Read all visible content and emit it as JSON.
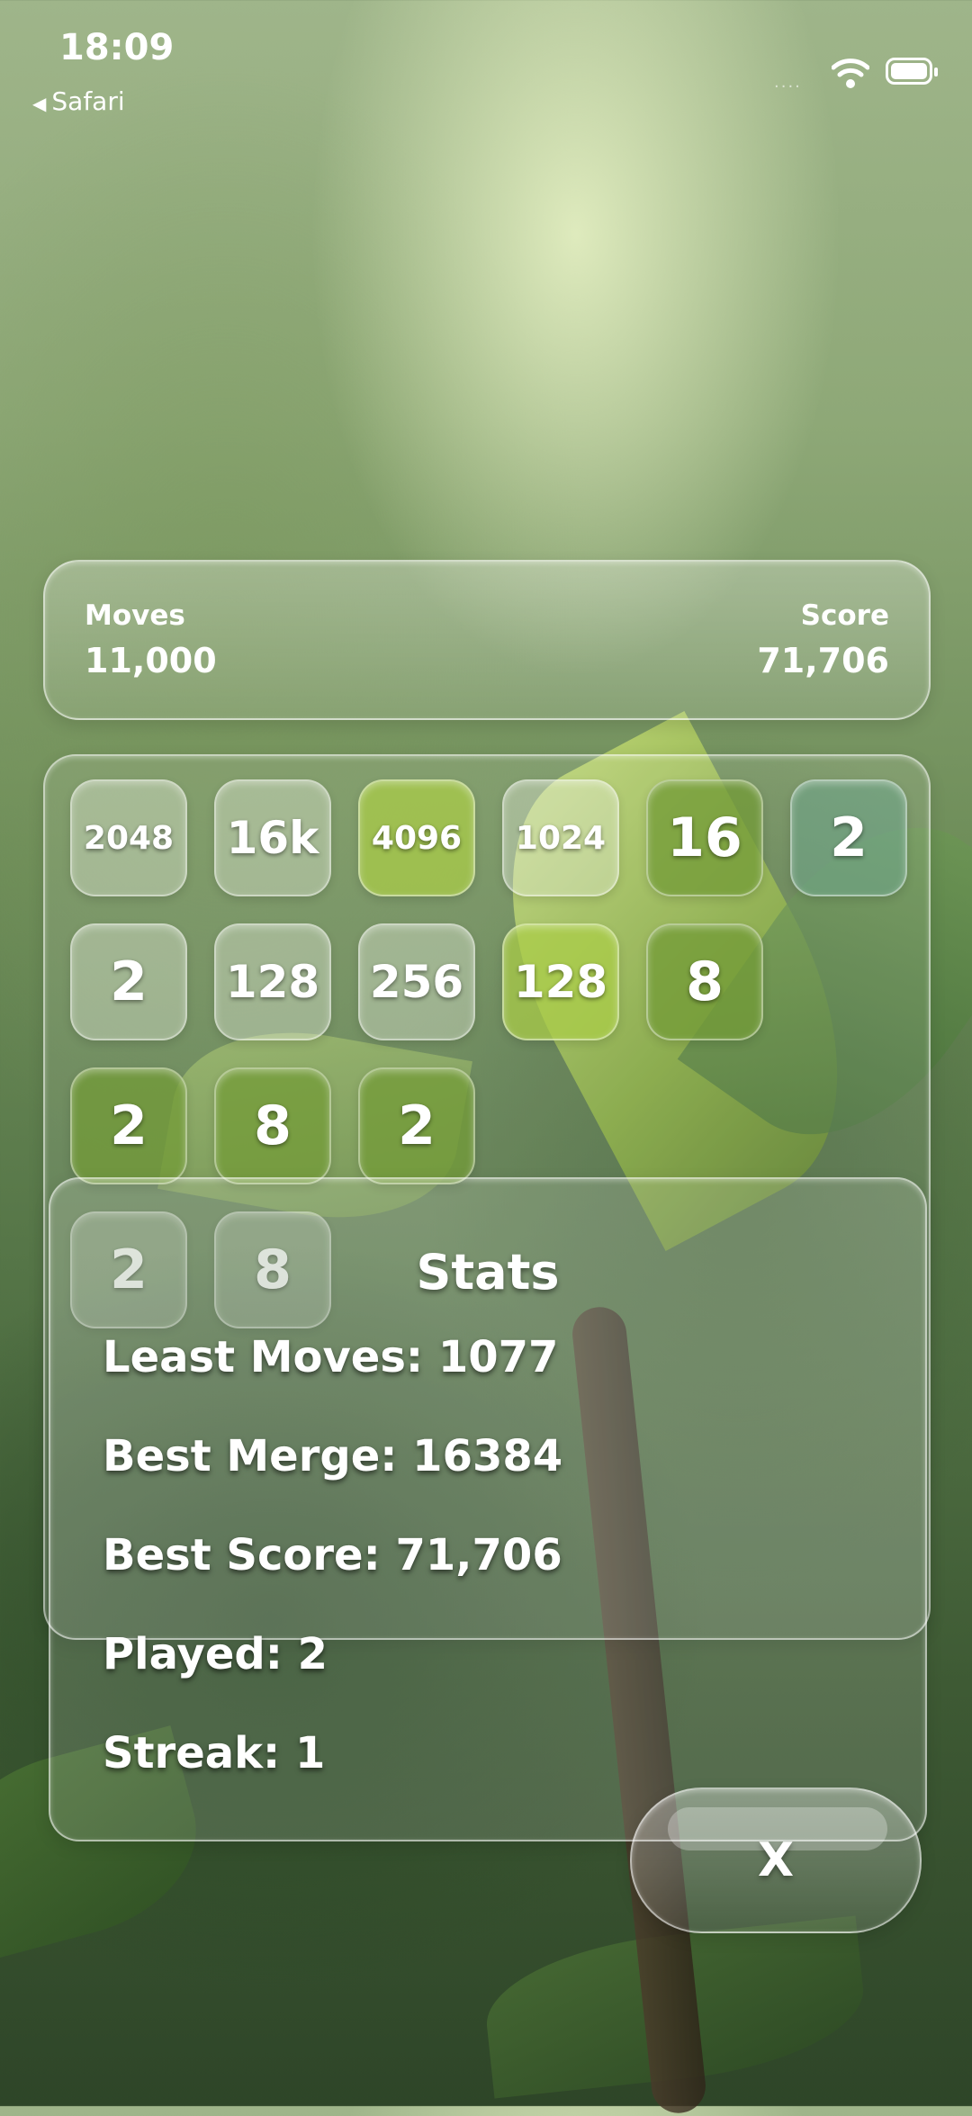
{
  "status_bar": {
    "time": "18:09",
    "back_label": "Safari",
    "signal": "····"
  },
  "header": {
    "moves_label": "Moves",
    "moves_value": "11,000",
    "score_label": "Score",
    "score_value": "71,706"
  },
  "board": {
    "tiles": [
      {
        "row": 0,
        "col": 0,
        "value": "2048",
        "style": "clear",
        "size": "s"
      },
      {
        "row": 0,
        "col": 1,
        "value": "16k",
        "style": "clear",
        "size": "m"
      },
      {
        "row": 0,
        "col": 2,
        "value": "4096",
        "style": "lime",
        "size": "s"
      },
      {
        "row": 0,
        "col": 3,
        "value": "1024",
        "style": "clear",
        "size": "s"
      },
      {
        "row": 0,
        "col": 4,
        "value": "16",
        "style": "olive",
        "size": "l"
      },
      {
        "row": 0,
        "col": 5,
        "value": "2",
        "style": "teal",
        "size": "l"
      },
      {
        "row": 1,
        "col": 0,
        "value": "2",
        "style": "clear",
        "size": "l"
      },
      {
        "row": 1,
        "col": 1,
        "value": "128",
        "style": "clear",
        "size": "m"
      },
      {
        "row": 1,
        "col": 2,
        "value": "256",
        "style": "clear",
        "size": "m"
      },
      {
        "row": 1,
        "col": 3,
        "value": "128",
        "style": "lime",
        "size": "m"
      },
      {
        "row": 1,
        "col": 4,
        "value": "8",
        "style": "olive",
        "size": "l"
      },
      {
        "row": 2,
        "col": 0,
        "value": "2",
        "style": "olive",
        "size": "l"
      },
      {
        "row": 2,
        "col": 1,
        "value": "8",
        "style": "olive",
        "size": "l"
      },
      {
        "row": 2,
        "col": 2,
        "value": "2",
        "style": "olive",
        "size": "l"
      },
      {
        "row": 3,
        "col": 0,
        "value": "2",
        "style": "ghost",
        "size": "l"
      },
      {
        "row": 3,
        "col": 1,
        "value": "8",
        "style": "ghost",
        "size": "l"
      }
    ]
  },
  "stats": {
    "title": "Stats",
    "least_moves": "Least Moves: 1077",
    "best_merge": "Best Merge: 16384",
    "best_score": "Best Score: 71,706",
    "played": "Played: 2",
    "streak": "Streak: 1"
  },
  "close_button": {
    "label": "X"
  },
  "colors": {
    "lime": "#aacd46",
    "olive": "#739b37",
    "teal": "#6ea58c"
  }
}
